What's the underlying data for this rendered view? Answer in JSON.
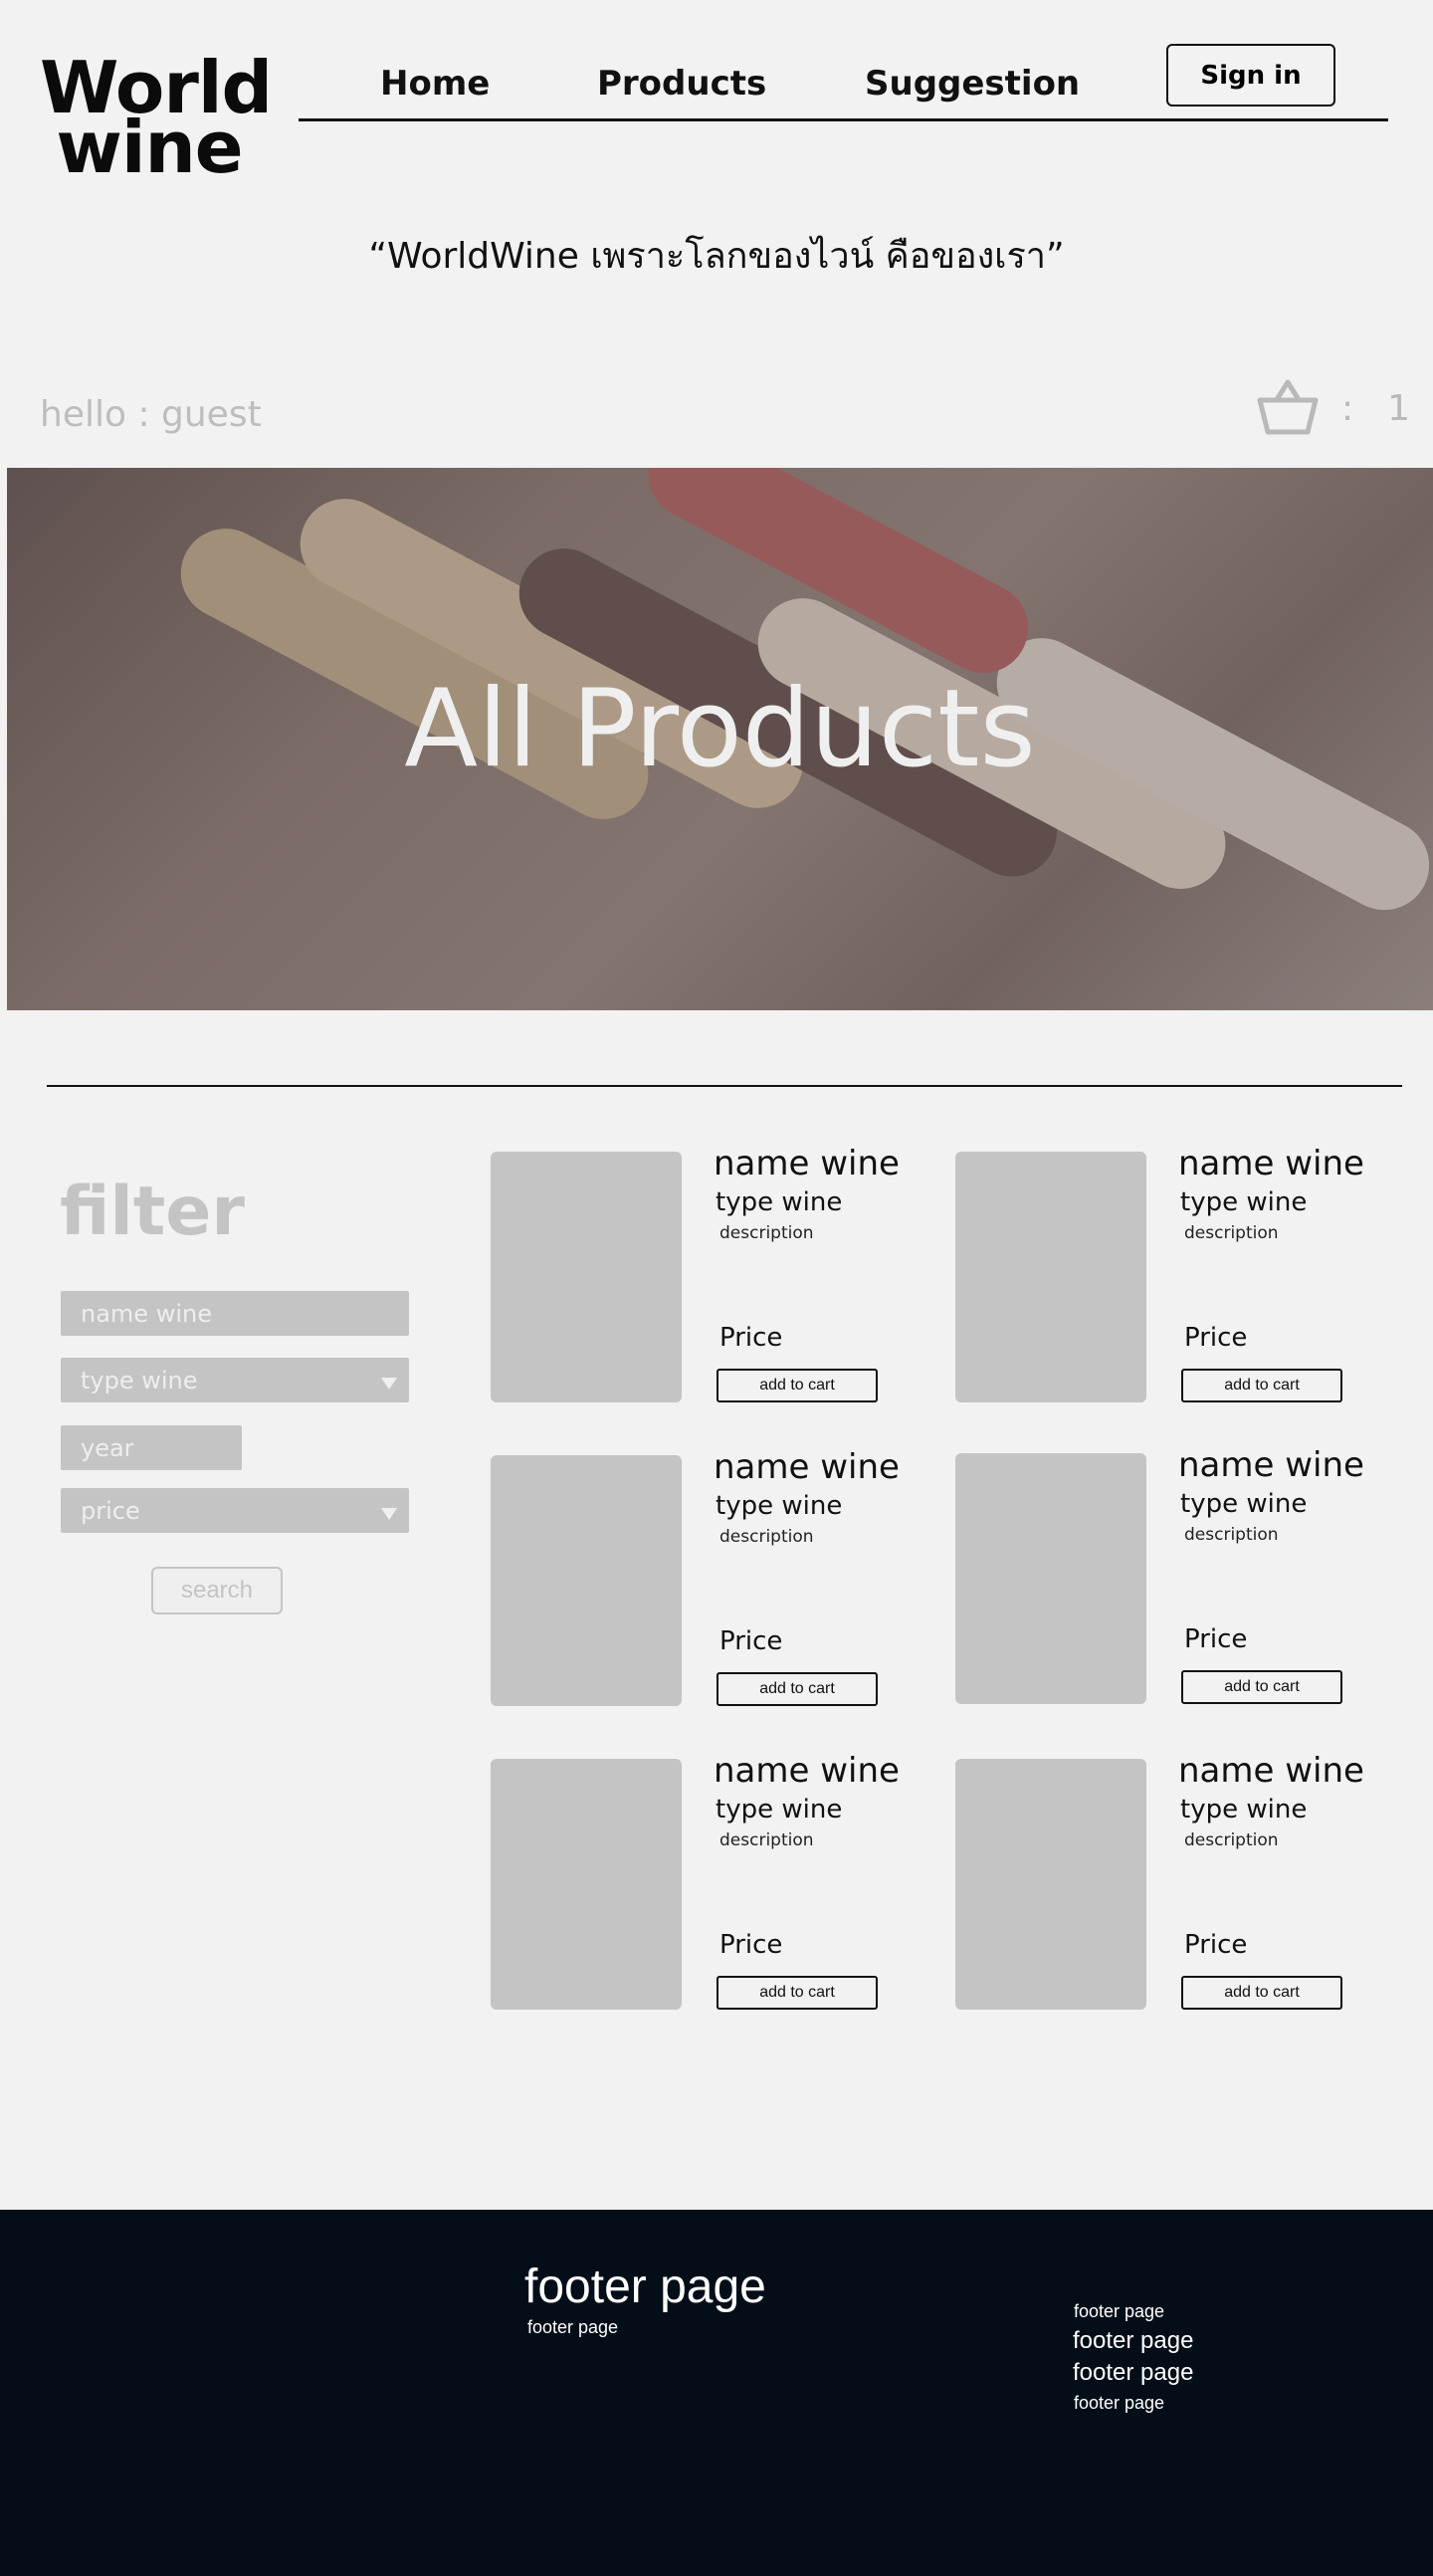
{
  "header": {
    "logo_line1": "World",
    "logo_line2": "wine",
    "nav": {
      "home": "Home",
      "products": "Products",
      "suggestion": "Suggestion"
    },
    "signin_label": "Sign in",
    "tagline": "“WorldWine เพราะโลกของไวน์ คือของเรา”"
  },
  "user": {
    "greeting": "hello : guest",
    "cart_separator": ":",
    "cart_count": "1",
    "cart_icon": "basket-icon"
  },
  "hero": {
    "title": "All Products"
  },
  "filter": {
    "title": "filter",
    "name_placeholder": "name wine",
    "type_placeholder": "type wine",
    "year_placeholder": "year",
    "price_placeholder": "price",
    "search_label": "search"
  },
  "products": [
    {
      "name": "name wine",
      "type": "type wine",
      "description": "description",
      "price": "Price",
      "button": "add to cart"
    },
    {
      "name": "name wine",
      "type": "type wine",
      "description": "description",
      "price": "Price",
      "button": "add to cart"
    },
    {
      "name": "name wine",
      "type": "type wine",
      "description": "description",
      "price": "Price",
      "button": "add to cart"
    },
    {
      "name": "name wine",
      "type": "type wine",
      "description": "description",
      "price": "Price",
      "button": "add to cart"
    },
    {
      "name": "name wine",
      "type": "type wine",
      "description": "description",
      "price": "Price",
      "button": "add to cart"
    },
    {
      "name": "name wine",
      "type": "type wine",
      "description": "description",
      "price": "Price",
      "button": "add to cart"
    }
  ],
  "footer": {
    "title": "footer page",
    "subtitle": "footer page",
    "links": [
      "footer page",
      "footer page",
      "footer page",
      "footer page"
    ]
  },
  "colors": {
    "background": "#f1f2f1",
    "placeholder_gray": "#c4c4c4",
    "footer_bg": "#040e18"
  }
}
